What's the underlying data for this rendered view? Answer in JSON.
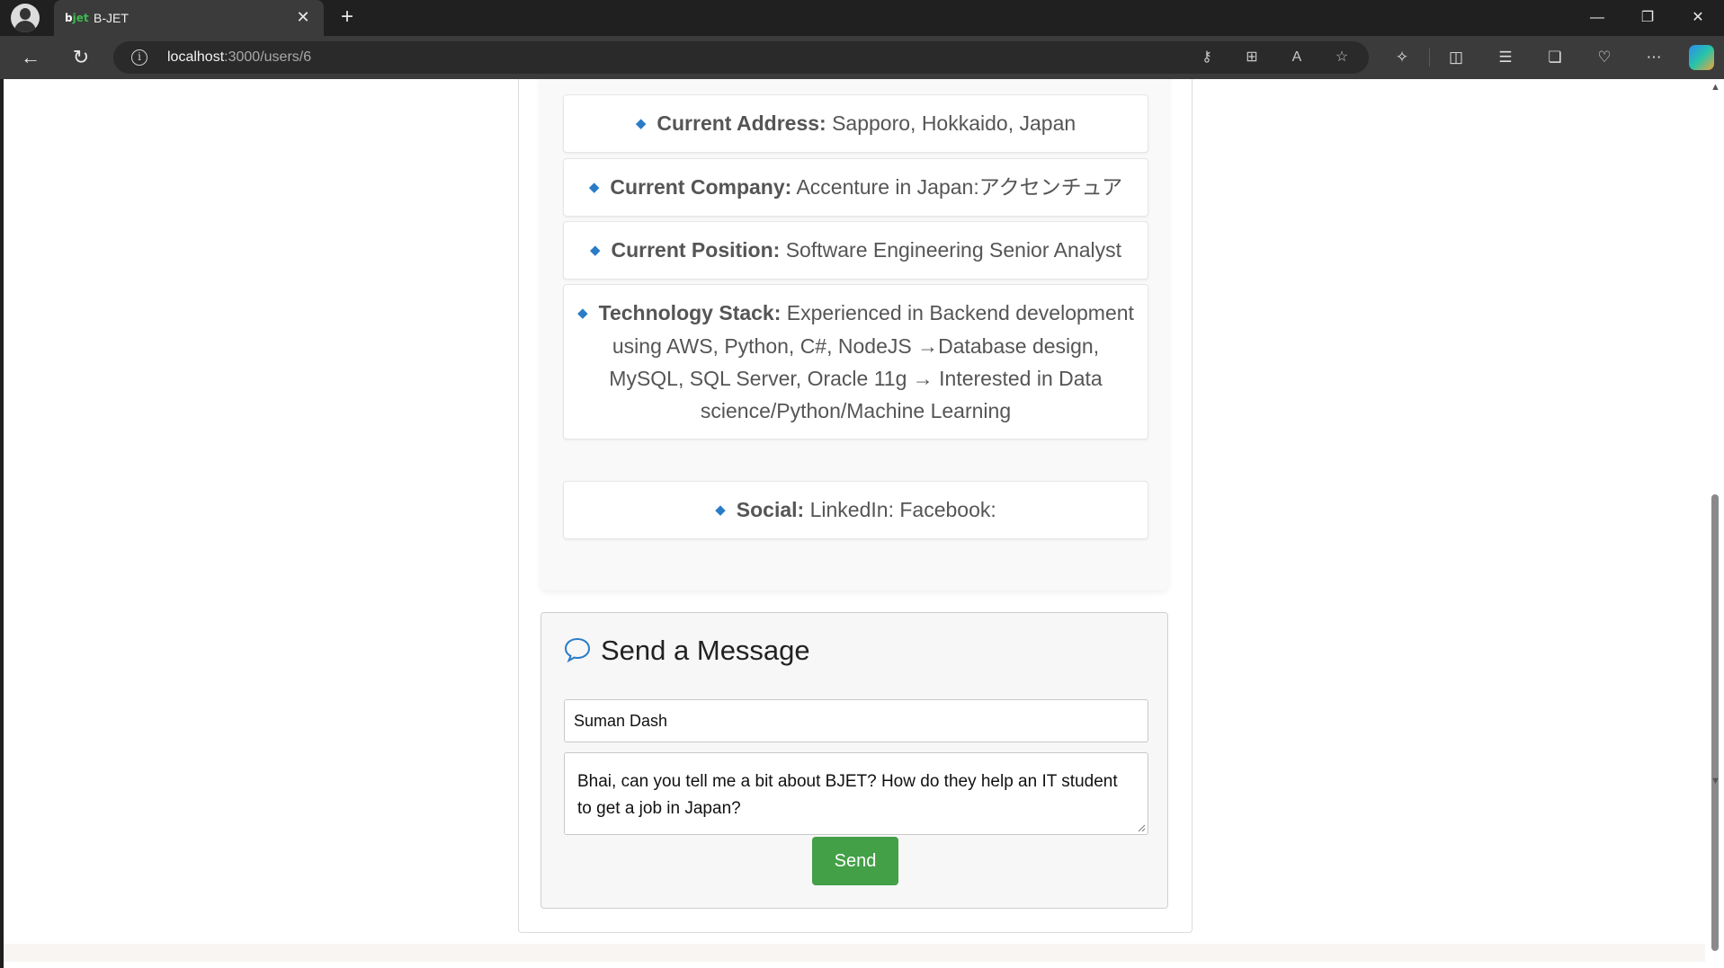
{
  "browser": {
    "tab_title": "B-JET",
    "favicon_text": "bjet",
    "url_host": "localhost",
    "url_path": ":3000/users/6",
    "icons": [
      "profile-avatar",
      "close-icon",
      "plus-icon",
      "minimize-icon",
      "restore-icon",
      "close-window-icon",
      "back-icon",
      "refresh-icon",
      "info-icon",
      "key-icon",
      "apps-icon",
      "read-aloud-icon",
      "favorite-star-icon",
      "extensions-icon",
      "split-screen-icon",
      "favorites-icon",
      "collections-icon",
      "browser-essentials-icon",
      "more-icon",
      "copilot-icon"
    ]
  },
  "profile": {
    "items": [
      {
        "key": "Current Address:",
        "value": "Sapporo, Hokkaido, Japan"
      },
      {
        "key": "Current Company:",
        "value": "Accenture in Japan:アクセンチュア"
      },
      {
        "key": "Current Position:",
        "value": "Software Engineering Senior Analyst"
      },
      {
        "key": "Technology Stack:",
        "value": "Experienced in Backend development using AWS, Python, C#, NodeJS →Database design, MySQL, SQL Server, Oracle 11g → Interested in Data science/Python/Machine Learning"
      },
      {
        "key": "Social:",
        "value": "LinkedIn: Facebook:"
      }
    ]
  },
  "message": {
    "title": "Send a Message",
    "name_value": "Suman Dash",
    "body_value": "Bhai, can you tell me a bit about BJET? How do they help an IT student to get a job in Japan?",
    "send_label": "Send"
  },
  "colors": {
    "accent_blue": "#2a7cc7",
    "send_green": "#43a047",
    "chrome_dark": "#202020"
  }
}
